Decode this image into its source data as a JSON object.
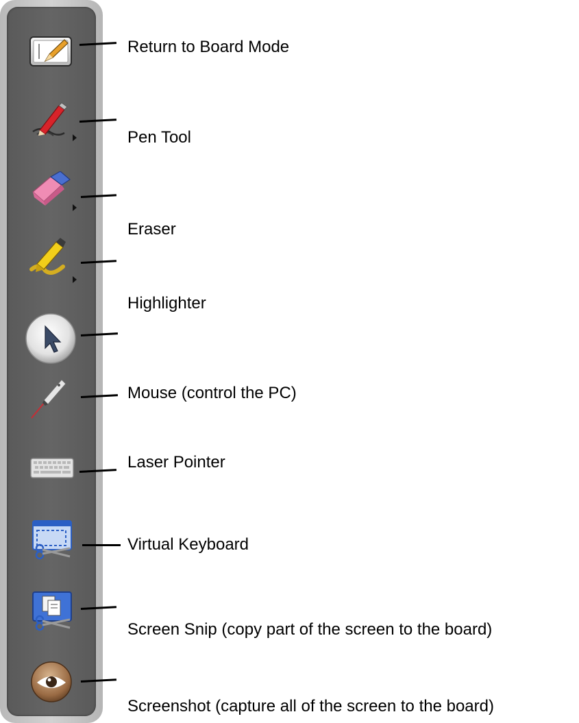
{
  "callouts": {
    "return_to_board": "Return to Board Mode",
    "pen_tool": "Pen Tool",
    "eraser": "Eraser",
    "highlighter": "Highlighter",
    "mouse": "Mouse (control the PC)",
    "laser_pointer": "Laser Pointer",
    "virtual_keyboard": "Virtual Keyboard",
    "screen_snip": "Screen Snip (copy part of the screen to the board)",
    "screenshot": "Screenshot (capture all of the screen to the board)"
  },
  "toolbar": {
    "buttons": [
      {
        "icon": "board-mode-icon"
      },
      {
        "icon": "pen-icon",
        "has_submenu": true
      },
      {
        "icon": "eraser-icon",
        "has_submenu": true
      },
      {
        "icon": "highlighter-icon",
        "has_submenu": true
      },
      {
        "icon": "mouse-pointer-icon",
        "selected": true
      },
      {
        "icon": "laser-pointer-icon"
      },
      {
        "icon": "keyboard-icon"
      },
      {
        "icon": "screen-snip-icon"
      },
      {
        "icon": "screenshot-icon"
      },
      {
        "icon": "eye-icon"
      }
    ]
  },
  "colors": {
    "toolbar_bg": "#5f5f5f",
    "toolbar_frame": "#c4c4c4",
    "pen_red": "#d8232a",
    "eraser_pink": "#f08cb4",
    "eraser_blue": "#4a6fd0",
    "highlighter_yellow": "#f2cf1a",
    "snip_blue": "#2b5fc4"
  }
}
